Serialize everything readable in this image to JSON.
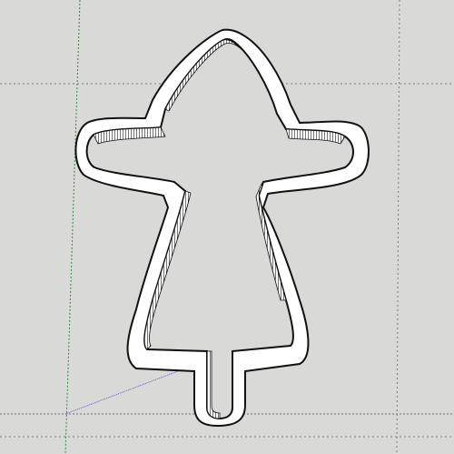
{
  "viewport": {
    "background_color": "#d9d9d7",
    "axis_colors": {
      "red": "#8a8a8a",
      "green": "#2e8a3a",
      "blue": "#4b4bd0"
    }
  },
  "model": {
    "object": "cookie-cutter",
    "style": "white-wall-with-black-edges"
  }
}
